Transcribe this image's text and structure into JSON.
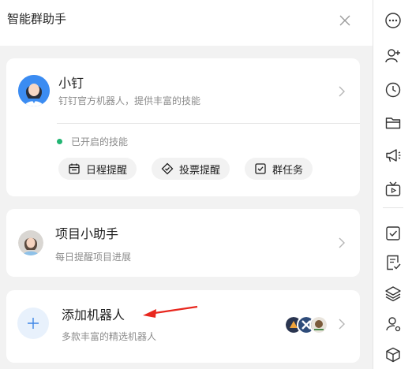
{
  "header": {
    "title": "智能群助手",
    "close_icon": "close-icon"
  },
  "xiaoding": {
    "name": "小钉",
    "description": "钉钉官方机器人，提供丰富的技能",
    "skills_status": "已开启的技能",
    "status_color": "#22b573",
    "skills": [
      {
        "label": "日程提醒",
        "icon": "calendar-icon"
      },
      {
        "label": "投票提醒",
        "icon": "vote-icon"
      },
      {
        "label": "群任务",
        "icon": "task-checkbox-icon"
      }
    ]
  },
  "project_assistant": {
    "name": "项目小助手",
    "description": "每日提醒项目进展"
  },
  "add_robot": {
    "title": "添加机器人",
    "description": "多款丰富的精选机器人",
    "accent": "#e8f1fc"
  },
  "annotation_color": "#e8271e",
  "sidebar": {
    "icons": [
      "more-dots-icon",
      "add-member-icon",
      "history-clock-icon",
      "folder-icon",
      "announcement-megaphone-icon",
      "live-tv-icon",
      "checkbox-icon",
      "approval-doc-icon",
      "layers-icon",
      "member-settings-icon",
      "app-box-icon"
    ]
  }
}
